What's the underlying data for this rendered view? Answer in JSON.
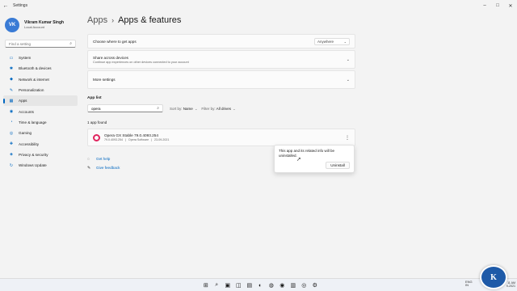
{
  "window": {
    "title": "Settings",
    "back_glyph": "←",
    "minimize_glyph": "–",
    "maximize_glyph": "□",
    "close_glyph": "✕"
  },
  "profile": {
    "name": "Vikram Kumar Singh",
    "account": "Local Account",
    "avatar_letters": "VK"
  },
  "sidebar": {
    "search_placeholder": "Find a setting",
    "search_icon": "⌕",
    "items": [
      {
        "label": "System",
        "icon": "▭"
      },
      {
        "label": "Bluetooth & devices",
        "icon": "✱"
      },
      {
        "label": "Network & internet",
        "icon": "◆"
      },
      {
        "label": "Personalization",
        "icon": "✎"
      },
      {
        "label": "Apps",
        "icon": "▦"
      },
      {
        "label": "Accounts",
        "icon": "◉"
      },
      {
        "label": "Time & language",
        "icon": "◔"
      },
      {
        "label": "Gaming",
        "icon": "◎"
      },
      {
        "label": "Accessibility",
        "icon": "✚"
      },
      {
        "label": "Privacy & security",
        "icon": "◈"
      },
      {
        "label": "Windows Update",
        "icon": "↻"
      }
    ]
  },
  "breadcrumb": {
    "parent": "Apps",
    "separator": "›",
    "current": "Apps & features"
  },
  "settings": {
    "where_label": "Choose where to get apps",
    "where_value": "Anywhere",
    "share_title": "Share across devices",
    "share_subtitle": "Continue app experiences on other devices connected to your account",
    "more_label": "More settings",
    "chevron": "⌄"
  },
  "app_list": {
    "title": "App list",
    "search_value": "opera",
    "search_icon": "⌕",
    "sort_label": "Sort by:",
    "sort_value": "Name",
    "filter_label": "Filter by:",
    "filter_value": "All drives",
    "found_text": "1 app found",
    "app": {
      "name": "Opera GX Stable 79.0.4093.254",
      "version": "79.0.4093.254",
      "publisher": "Opera Software",
      "date": "23-09-2021",
      "separator": "|",
      "more_glyph": "⋮"
    }
  },
  "links": {
    "help": "Get help",
    "feedback": "Give feedback",
    "help_icon": "◌",
    "feedback_icon": "✎"
  },
  "flyout": {
    "message": "This app and its related info will be uninstalled.",
    "button": "Uninstall"
  },
  "taskbar": {
    "icons": [
      "⊞",
      "⌕",
      "▣",
      "◫",
      "▤",
      "◐",
      "◍",
      "◉",
      "▥",
      "◎",
      "⚙"
    ],
    "lang_top": "ENG",
    "lang_bottom": "IN",
    "time": "11 AM",
    "date": "9-2021"
  },
  "watermark": {
    "letters": "K"
  },
  "colors": {
    "accent": "#0067c0",
    "opera_red": "#e0245e"
  }
}
